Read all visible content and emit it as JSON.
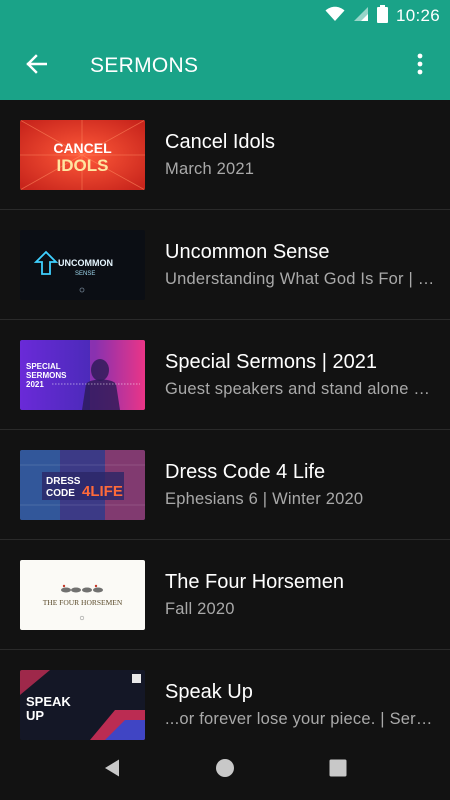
{
  "status_bar": {
    "time": "10:26",
    "icons": [
      "wifi-icon",
      "signal-icon",
      "battery-icon"
    ]
  },
  "app_bar": {
    "title": "SERMONS",
    "background": "#1aa388",
    "back_icon": "arrow-back-icon",
    "menu_icon": "more-vert-icon"
  },
  "sermons": [
    {
      "title": "Cancel Idols",
      "subtitle": "March 2021",
      "thumb_text": [
        "CANCEL",
        "IDOLS"
      ]
    },
    {
      "title": "Uncommon Sense",
      "subtitle": "Understanding What God Is For | Just Understanding",
      "thumb_text": [
        "UNCOMMON",
        "SENSE"
      ]
    },
    {
      "title": "Special Sermons | 2021",
      "subtitle": "Guest speakers and stand alone messages",
      "thumb_text": [
        "SPECIAL",
        "SERMONS",
        "2021"
      ]
    },
    {
      "title": "Dress Code 4 Life",
      "subtitle": "Ephesians 6 | Winter 2020",
      "thumb_text": [
        "DRESS",
        "CODE",
        "4LIFE"
      ]
    },
    {
      "title": "The Four Horsemen",
      "subtitle": "Fall 2020",
      "thumb_text": [
        "THE FOUR HORSEMEN"
      ]
    },
    {
      "title": "Speak Up",
      "subtitle": "...or forever lose your piece. | Series",
      "thumb_text": [
        "SPEAK",
        "UP"
      ]
    }
  ],
  "nav_bar": {
    "icons": [
      "back-triangle-icon",
      "home-circle-icon",
      "recents-square-icon"
    ]
  }
}
